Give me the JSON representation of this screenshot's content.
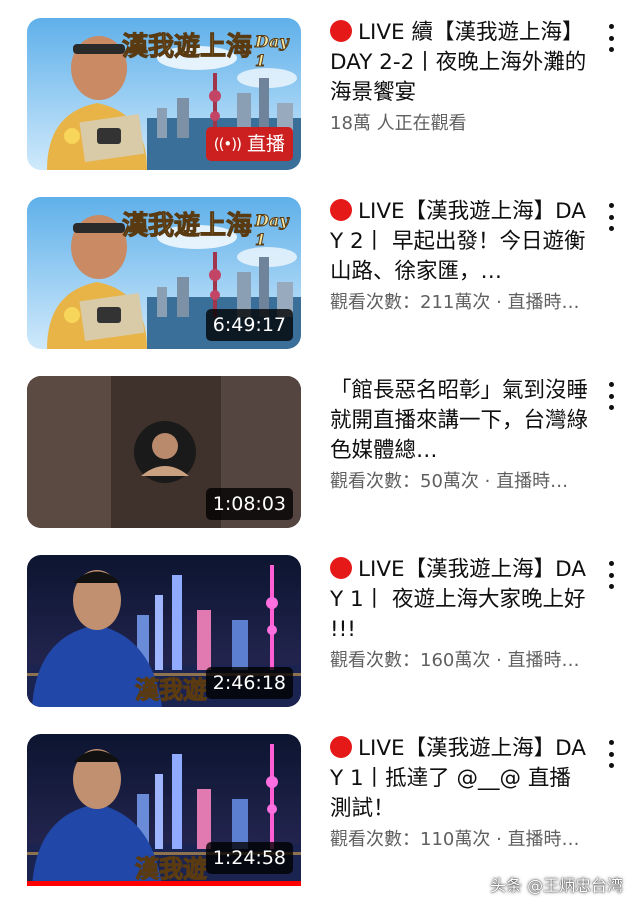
{
  "videos": [
    {
      "live_dot": true,
      "title": "LIVE 續【漢我遊上海】DAY 2-2丨夜晚上海外灘的海景饗宴",
      "subtitle": "18萬 人正在觀看",
      "badge_type": "live",
      "badge": "直播",
      "thumb_caption": "漢我遊上海",
      "thumb_caption2": "Day 1"
    },
    {
      "live_dot": true,
      "title": "LIVE【漢我遊上海】DAY 2丨 早起出發！今日遊衡山路、徐家匯，…",
      "subtitle": "觀看次數：211萬次 · 直播時…",
      "badge_type": "duration",
      "badge": "6:49:17",
      "thumb_caption": "漢我遊上海",
      "thumb_caption2": "Day 1"
    },
    {
      "live_dot": false,
      "title": "「館長惡名昭彰」氣到沒睡 就開直播來講一下，台灣綠色媒體總…",
      "subtitle": "觀看次數：50萬次 · 直播時…",
      "badge_type": "duration",
      "badge": "1:08:03"
    },
    {
      "live_dot": true,
      "title": "LIVE【漢我遊上海】DAY 1丨 夜遊上海大家晚上好 !!!",
      "subtitle": "觀看次數：160萬次 · 直播時…",
      "badge_type": "duration",
      "badge": "2:46:18",
      "thumb_caption": "漢我遊"
    },
    {
      "live_dot": true,
      "title": "LIVE【漢我遊上海】DAY 1丨抵達了 @__@ 直播測試！",
      "subtitle": "觀看次數：110萬次 · 直播時…",
      "badge_type": "duration",
      "badge": "1:24:58",
      "thumb_caption": "漢我遊",
      "progress_fraction": 1.0
    }
  ],
  "watermark": "头条 @王炳忠台湾",
  "colors": {
    "live_red": "#e61919",
    "badge_red": "#cc1f1f",
    "progress": "#ff0000"
  },
  "icons": [
    "more-vert-icon",
    "live-radio-icon"
  ]
}
